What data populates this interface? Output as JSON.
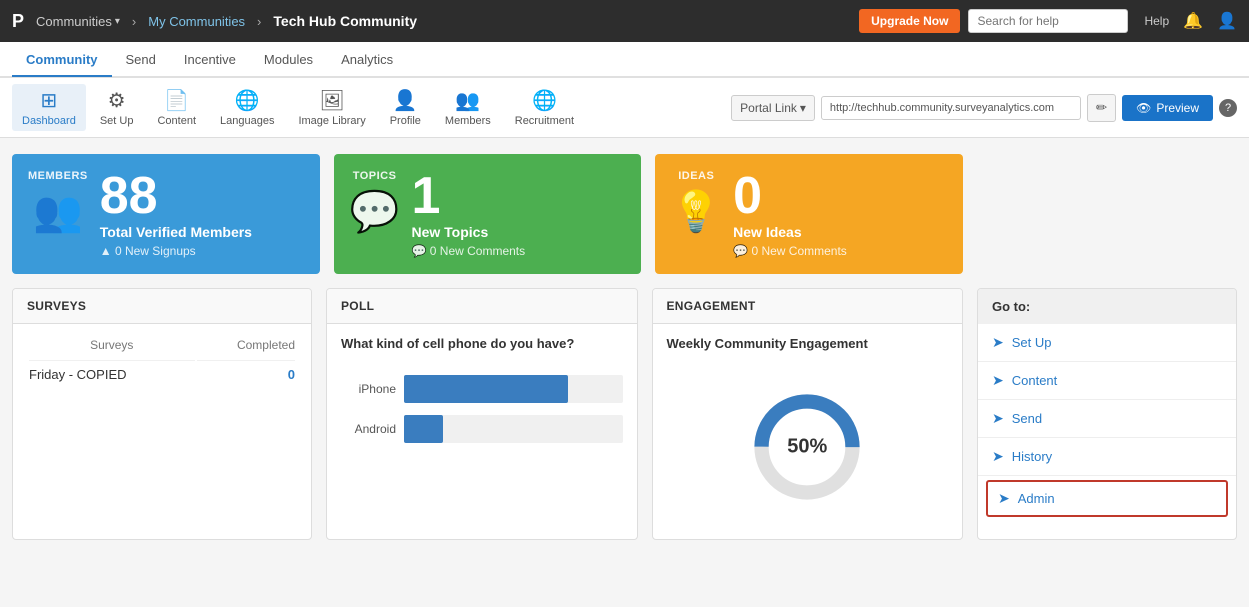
{
  "topnav": {
    "brand": "P",
    "communities_label": "Communities",
    "my_communities_label": "My Communities",
    "current_community": "Tech Hub Community",
    "upgrade_label": "Upgrade Now",
    "search_placeholder": "Search for help",
    "help_label": "Help"
  },
  "secnav": {
    "items": [
      {
        "label": "Community",
        "active": true
      },
      {
        "label": "Send",
        "active": false
      },
      {
        "label": "Incentive",
        "active": false
      },
      {
        "label": "Modules",
        "active": false
      },
      {
        "label": "Analytics",
        "active": false
      }
    ]
  },
  "toolbar": {
    "tools": [
      {
        "label": "Dashboard",
        "icon": "⊞",
        "active": true
      },
      {
        "label": "Set Up",
        "icon": "⚙",
        "active": false
      },
      {
        "label": "Content",
        "icon": "📄",
        "active": false
      },
      {
        "label": "Languages",
        "icon": "🌐",
        "active": false
      },
      {
        "label": "Image Library",
        "icon": "🖼",
        "active": false
      },
      {
        "label": "Profile",
        "icon": "👤",
        "active": false
      },
      {
        "label": "Members",
        "icon": "👥",
        "active": false
      },
      {
        "label": "Recruitment",
        "icon": "🌐",
        "active": false
      }
    ],
    "portal_link_label": "Portal Link",
    "portal_url": "http://techhub.community.surveyanalytics.com",
    "preview_label": "Preview"
  },
  "members_card": {
    "label": "MEMBERS",
    "number": "88",
    "title": "Total Verified Members",
    "sub": "0 New Signups"
  },
  "topics_card": {
    "label": "TOPICS",
    "number": "1",
    "title": "New Topics",
    "sub": "0 New Comments"
  },
  "ideas_card": {
    "label": "IDEAS",
    "number": "0",
    "title": "New Ideas",
    "sub": "0 New Comments"
  },
  "surveys": {
    "header": "SURVEYS",
    "col_survey": "Surveys",
    "col_completed": "Completed",
    "rows": [
      {
        "name": "Friday - COPIED",
        "completed": "0"
      }
    ]
  },
  "poll": {
    "header": "POLL",
    "question": "What kind of cell phone do you have?",
    "bars": [
      {
        "label": "iPhone",
        "value": 75
      },
      {
        "label": "Android",
        "value": 18
      }
    ]
  },
  "engagement": {
    "header": "ENGAGEMENT",
    "title": "Weekly Community Engagement",
    "percentage": "50%",
    "donut_filled": 50,
    "donut_empty": 50
  },
  "sidebar": {
    "header": "Go to:",
    "items": [
      {
        "label": "Set Up",
        "icon": "➤"
      },
      {
        "label": "Content",
        "icon": "➤"
      },
      {
        "label": "Send",
        "icon": "➤"
      },
      {
        "label": "History",
        "icon": "➤"
      },
      {
        "label": "Admin",
        "icon": "➤",
        "admin": true
      }
    ]
  }
}
